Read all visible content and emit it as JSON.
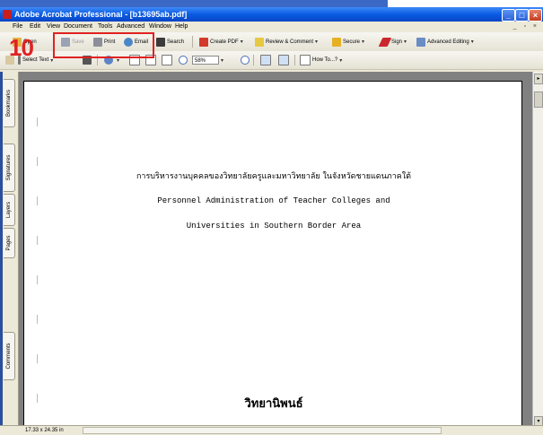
{
  "window": {
    "title": "Adobe Acrobat Professional - [b13695ab.pdf]"
  },
  "menu": [
    "File",
    "Edit",
    "View",
    "Document",
    "Tools",
    "Advanced",
    "Window",
    "Help"
  ],
  "toolbar1": {
    "open": "Open",
    "save": "Save",
    "print": "Print",
    "email": "Email",
    "search": "Search",
    "create_pdf": "Create PDF",
    "review": "Review & Comment",
    "secure": "Secure",
    "sign": "Sign",
    "advanced_editing": "Advanced Editing"
  },
  "toolbar2": {
    "select_text": "Select Text",
    "zoom": "58%",
    "how_to": "How To...?"
  },
  "annotation": {
    "step": "10",
    "color": "#e02222"
  },
  "nav_tabs": [
    "Bookmarks",
    "Signatures",
    "Layers",
    "Pages",
    "Comments"
  ],
  "document": {
    "thai_title": "การบริหารงานบุคคลของวิทยาลัยครูและมหาวิทยาลัย ในจังหวัดชายแดนภาคใต้",
    "english_line1": "Personnel Administration of Teacher Colleges and",
    "english_line2": "Universities in Southern Border Area",
    "thai_footer": "วิทยานิพนธ์"
  },
  "status": {
    "page_size": "17.33 x 24.35 in"
  }
}
